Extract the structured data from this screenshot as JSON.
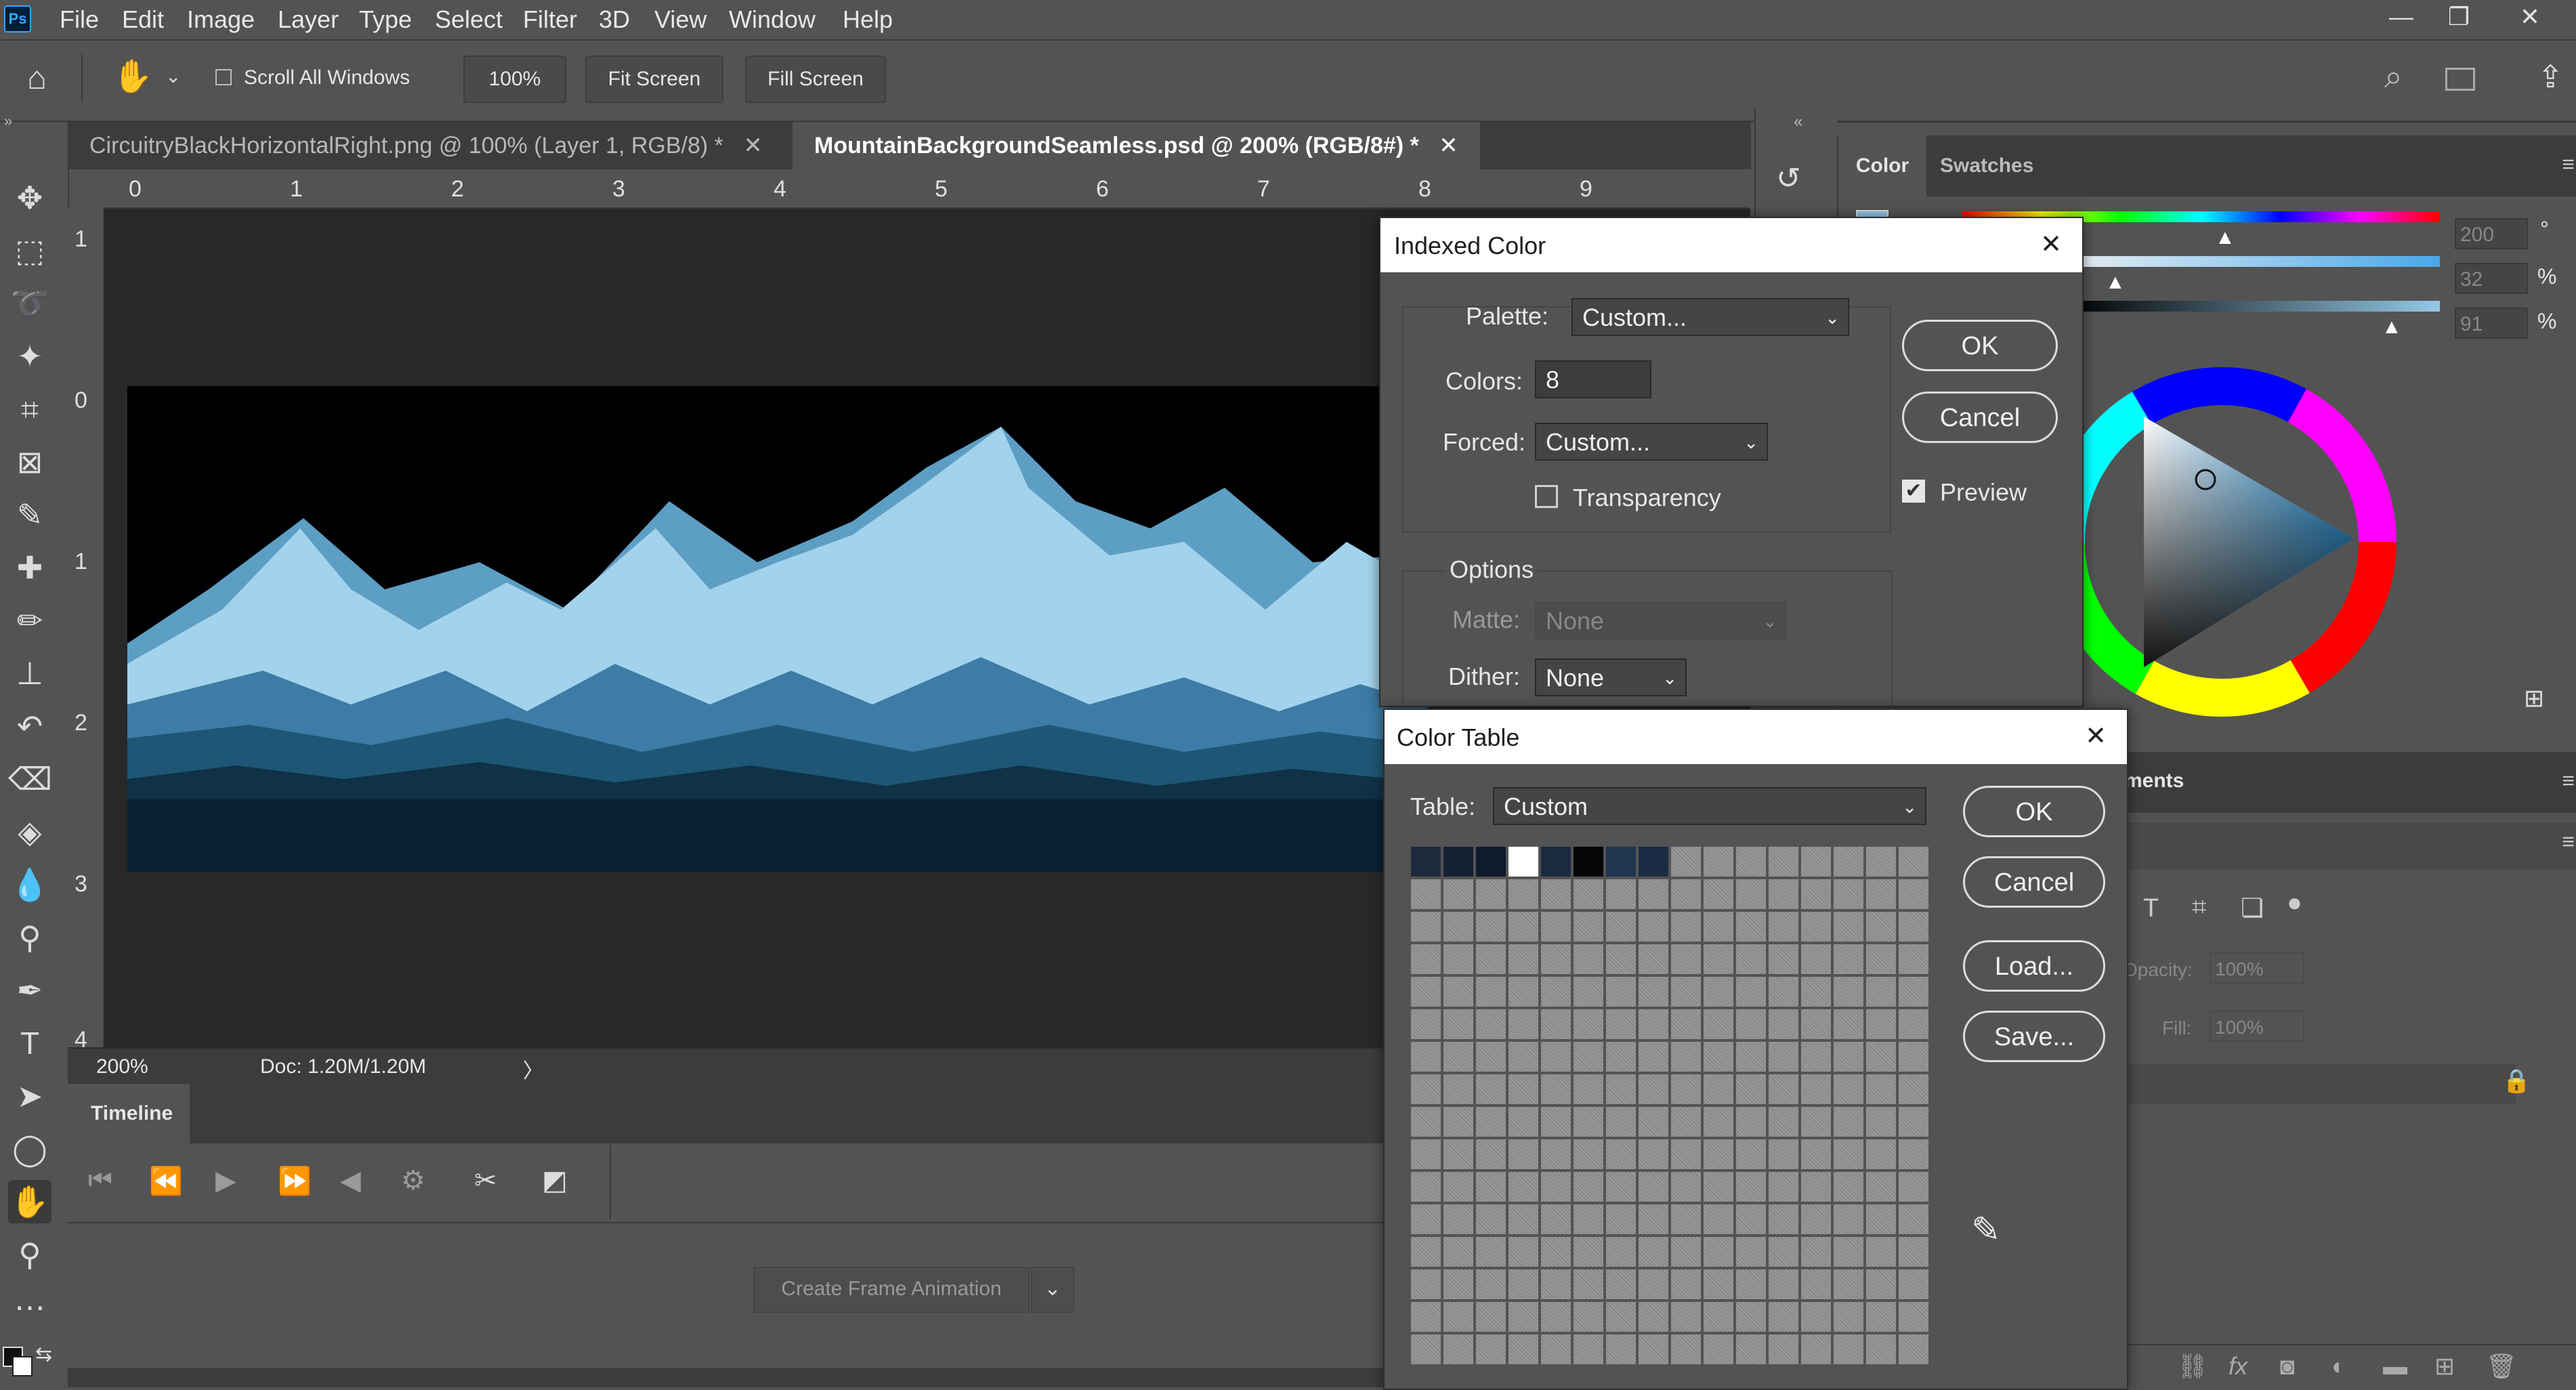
{
  "app": {
    "logo": "Ps"
  },
  "menubar": {
    "items": [
      "File",
      "Edit",
      "Image",
      "Layer",
      "Type",
      "Select",
      "Filter",
      "3D",
      "View",
      "Window",
      "Help"
    ]
  },
  "options": {
    "scroll_all_windows": "Scroll All Windows",
    "zoom": "100%",
    "fit_screen": "Fit Screen",
    "fill_screen": "Fill Screen"
  },
  "tabs": [
    {
      "label": "CircuitryBlackHorizontalRight.png @ 100% (Layer 1, RGB/8) *",
      "active": false
    },
    {
      "label": "MountainBackgroundSeamless.psd @ 200% (RGB/8#) *",
      "active": true
    }
  ],
  "ruler": {
    "top": [
      "0",
      "1",
      "2",
      "3",
      "4",
      "5",
      "6",
      "7",
      "8",
      "9"
    ],
    "left": [
      "1",
      "0",
      "1",
      "2",
      "3",
      "4"
    ]
  },
  "status": {
    "zoom": "200%",
    "doc": "Doc: 1.20M/1.20M"
  },
  "timeline": {
    "tab": "Timeline",
    "create_button": "Create Frame Animation"
  },
  "color_panel": {
    "tab_color": "Color",
    "tab_swatches": "Swatches",
    "h": "200",
    "s": "32",
    "b": "91",
    "deg": "°",
    "pct": "%"
  },
  "layers_panel": {
    "tab": "ments",
    "opacity_label": "Opacity:",
    "opacity": "100%",
    "fill_label": "Fill:",
    "fill": "100%"
  },
  "indexed_color": {
    "title": "Indexed Color",
    "palette_label": "Palette:",
    "palette": "Custom...",
    "colors_label": "Colors:",
    "colors": "8",
    "forced_label": "Forced:",
    "forced": "Custom...",
    "transparency": "Transparency",
    "options": "Options",
    "matte_label": "Matte:",
    "matte": "None",
    "dither_label": "Dither:",
    "dither": "None",
    "ok": "OK",
    "cancel": "Cancel",
    "preview": "Preview"
  },
  "color_table": {
    "title": "Color Table",
    "table_label": "Table:",
    "table": "Custom",
    "ok": "OK",
    "cancel": "Cancel",
    "load": "Load...",
    "save": "Save...",
    "swatches": [
      "#1c2b3c",
      "#152033",
      "#0f1a2a",
      "#ffffff",
      "#1a2a40",
      "#050505",
      "#223550",
      "#1a2c45"
    ]
  },
  "colors": {
    "ui": "#535353",
    "dark": "#3c3c3c",
    "canvas": "#282828",
    "dialog_title": "#ffffff"
  }
}
